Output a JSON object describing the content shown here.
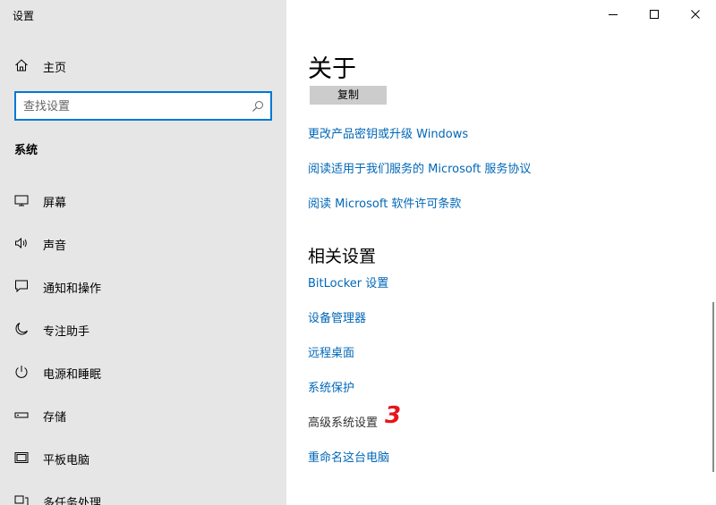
{
  "window": {
    "title": "设置",
    "controls": {
      "minimize": "–",
      "maximize": "□",
      "close": "✕"
    }
  },
  "sidebar": {
    "home_label": "主页",
    "search_placeholder": "查找设置",
    "section_title": "系统",
    "items": [
      {
        "label": "屏幕",
        "icon": "monitor-icon"
      },
      {
        "label": "声音",
        "icon": "speaker-icon"
      },
      {
        "label": "通知和操作",
        "icon": "notification-icon"
      },
      {
        "label": "专注助手",
        "icon": "moon-icon"
      },
      {
        "label": "电源和睡眠",
        "icon": "power-icon"
      },
      {
        "label": "存储",
        "icon": "storage-icon"
      },
      {
        "label": "平板电脑",
        "icon": "tablet-icon"
      },
      {
        "label": "多任务处理",
        "icon": "multitask-icon"
      }
    ]
  },
  "main": {
    "title": "关于",
    "copy_button": "复制",
    "links": [
      "更改产品密钥或升级 Windows",
      "阅读适用于我们服务的 Microsoft 服务协议",
      "阅读 Microsoft 软件许可条款"
    ],
    "related_title": "相关设置",
    "related_links": [
      "BitLocker 设置",
      "设备管理器",
      "远程桌面",
      "系统保护",
      "高级系统设置",
      "重命名这台电脑"
    ],
    "annotation": "3",
    "annotation_color": "#e8141c"
  },
  "colors": {
    "sidebar_bg": "#e6e6e6",
    "link": "#0067b8",
    "accent": "#0078d7"
  }
}
